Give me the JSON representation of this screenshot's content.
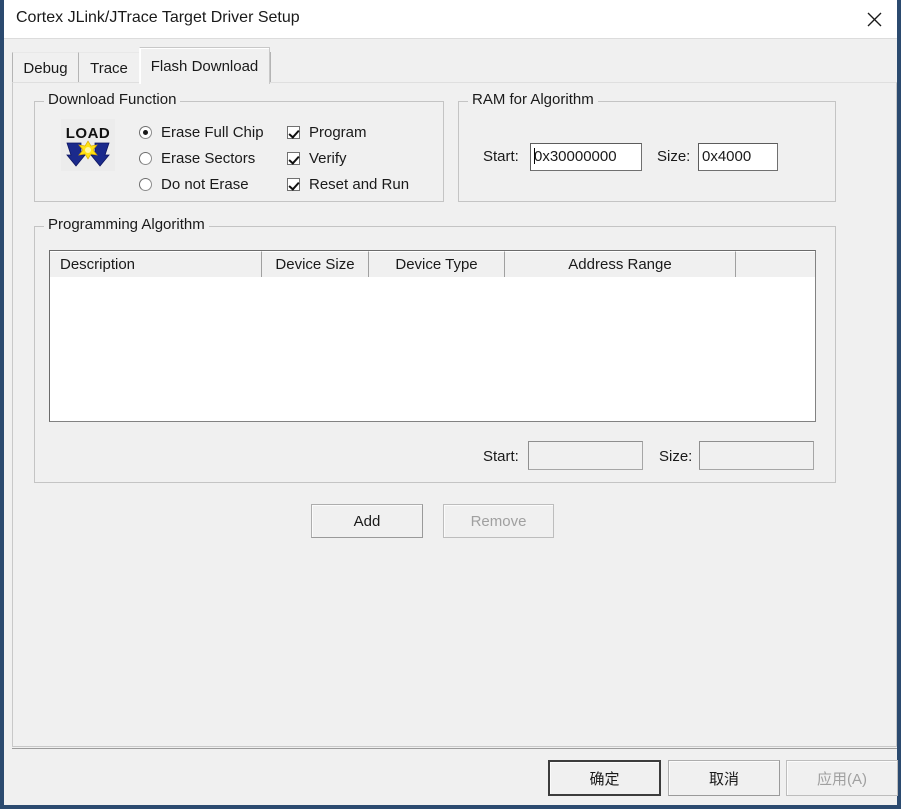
{
  "window": {
    "title": "Cortex JLink/JTrace Target Driver Setup",
    "close_icon": "close-icon",
    "border_color": "#2b4a6f",
    "background": "#f0f0f0"
  },
  "tabs": [
    {
      "label": "Debug",
      "selected": false
    },
    {
      "label": "Trace",
      "selected": false
    },
    {
      "label": "Flash Download",
      "selected": true
    }
  ],
  "download_function": {
    "title": "Download Function",
    "icon": "load-icon",
    "radios": [
      {
        "label": "Erase Full Chip",
        "checked": true
      },
      {
        "label": "Erase Sectors",
        "checked": false
      },
      {
        "label": "Do not Erase",
        "checked": false
      }
    ],
    "checkboxes": [
      {
        "label": "Program",
        "checked": true
      },
      {
        "label": "Verify",
        "checked": true
      },
      {
        "label": "Reset and Run",
        "checked": true
      }
    ]
  },
  "ram_for_algorithm": {
    "title": "RAM for Algorithm",
    "start_label": "Start:",
    "start_value": "0x30000000",
    "size_label": "Size:",
    "size_value": "0x4000"
  },
  "programming_algorithm": {
    "title": "Programming Algorithm",
    "columns": [
      "Description",
      "Device Size",
      "Device Type",
      "Address Range",
      ""
    ],
    "rows": [],
    "start_label": "Start:",
    "start_value": "",
    "size_label": "Size:",
    "size_value": "",
    "add_label": "Add",
    "remove_label": "Remove",
    "remove_enabled": false
  },
  "footer": {
    "ok_label": "确定",
    "cancel_label": "取消",
    "apply_label": "应用(A)",
    "apply_enabled": false
  }
}
